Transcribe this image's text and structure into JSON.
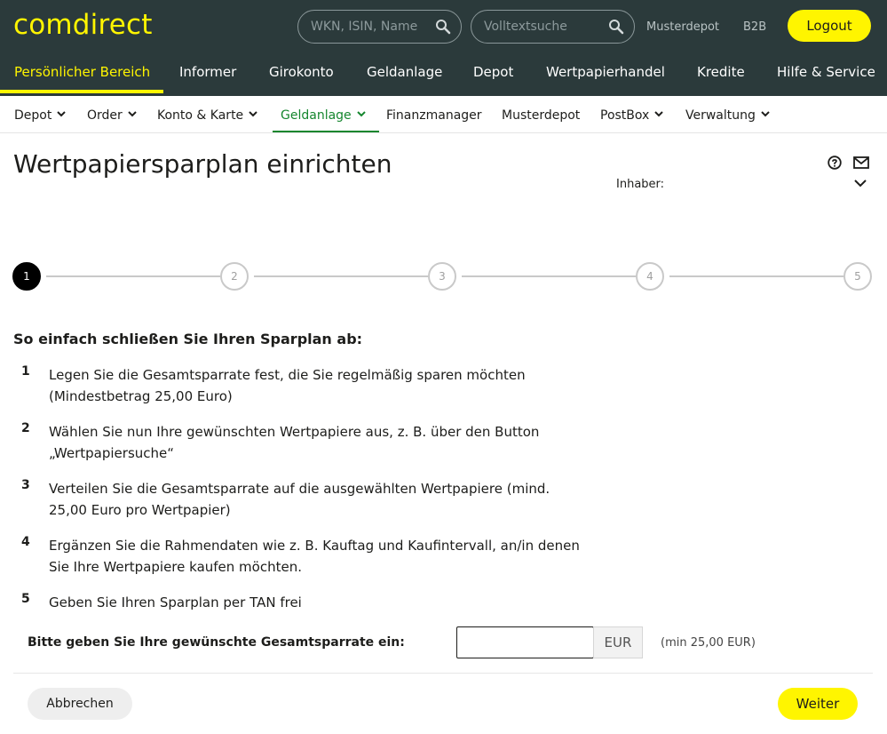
{
  "header": {
    "logo_text": "comdirect",
    "search_wkn_placeholder": "WKN, ISIN, Name",
    "search_fulltext_placeholder": "Volltextsuche",
    "link_musterdepot": "Musterdepot",
    "link_b2b": "B2B",
    "logout_label": "Logout",
    "brand_color": "#fff500",
    "header_bg_color": "#2b3a3b"
  },
  "main_nav": {
    "items": [
      {
        "label": "Persönlicher Bereich",
        "active": true
      },
      {
        "label": "Informer"
      },
      {
        "label": "Girokonto"
      },
      {
        "label": "Geldanlage"
      },
      {
        "label": "Depot"
      },
      {
        "label": "Wertpapierhandel"
      },
      {
        "label": "Kredite"
      },
      {
        "label": "Hilfe & Service"
      }
    ]
  },
  "sub_nav": {
    "items": [
      {
        "label": "Depot",
        "has_dropdown": true
      },
      {
        "label": "Order",
        "has_dropdown": true
      },
      {
        "label": "Konto & Karte",
        "has_dropdown": true
      },
      {
        "label": "Geldanlage",
        "has_dropdown": true,
        "active": true
      },
      {
        "label": "Finanzmanager"
      },
      {
        "label": "Musterdepot"
      },
      {
        "label": "PostBox",
        "has_dropdown": true
      },
      {
        "label": "Verwaltung",
        "has_dropdown": true
      }
    ],
    "active_color": "#15862e"
  },
  "page": {
    "title": "Wertpapiersparplan einrichten",
    "owner_label": "Inhaber:"
  },
  "stepper": {
    "steps": [
      "1",
      "2",
      "3",
      "4",
      "5"
    ],
    "current": "1"
  },
  "content": {
    "intro": "So einfach schließen Sie Ihren Sparplan ab:",
    "steps": [
      {
        "num": "1",
        "text": "Legen Sie die Gesamtsparrate fest, die Sie regelmäßig sparen möchten (Mindestbetrag 25,00 Euro)"
      },
      {
        "num": "2",
        "text": "Wählen Sie nun Ihre gewünschten Wertpapiere aus, z. B. über den Button „Wertpapiersuche“"
      },
      {
        "num": "3",
        "text": "Verteilen Sie die Gesamtsparrate auf die ausgewählten Wertpapiere (mind. 25,00 Euro pro Wertpapier)"
      },
      {
        "num": "4",
        "text": "Ergänzen Sie die Rahmendaten wie z. B. Kauftag und Kaufintervall, an/in denen Sie Ihre Wertpapiere kaufen möchten."
      },
      {
        "num": "5",
        "text": "Geben Sie Ihren Sparplan per TAN frei"
      }
    ]
  },
  "amount": {
    "label": "Bitte geben Sie Ihre gewünschte Gesamtsparrate ein:",
    "value": "",
    "unit": "EUR",
    "hint": "(min 25,00 EUR)"
  },
  "actions": {
    "cancel_label": "Abbrechen",
    "next_label": "Weiter"
  }
}
